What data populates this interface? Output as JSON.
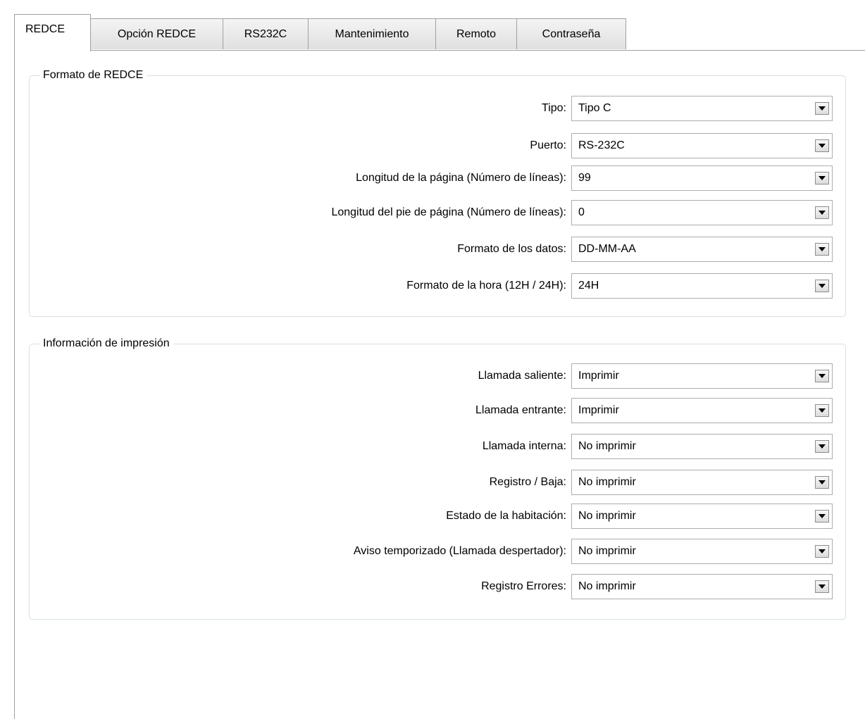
{
  "tabs": [
    {
      "label": "REDCE",
      "active": true
    },
    {
      "label": "Opción REDCE",
      "active": false
    },
    {
      "label": "RS232C",
      "active": false
    },
    {
      "label": "Mantenimiento",
      "active": false
    },
    {
      "label": "Remoto",
      "active": false
    },
    {
      "label": "Contraseña",
      "active": false
    }
  ],
  "format_group": {
    "title": "Formato de REDCE",
    "rows": [
      {
        "label": "Tipo:",
        "value": "Tipo C"
      },
      {
        "label": "Puerto:",
        "value": "RS-232C"
      },
      {
        "label": "Longitud de la página (Número de líneas):",
        "value": "99"
      },
      {
        "label": "Longitud del pie de página (Número de líneas):",
        "value": "0"
      },
      {
        "label": "Formato de los datos:",
        "value": "DD-MM-AA"
      },
      {
        "label": "Formato de la hora (12H / 24H):",
        "value": "24H"
      }
    ]
  },
  "print_group": {
    "title": "Información de impresión",
    "rows": [
      {
        "label": "Llamada saliente:",
        "value": "Imprimir"
      },
      {
        "label": "Llamada entrante:",
        "value": "Imprimir"
      },
      {
        "label": "Llamada interna:",
        "value": "No imprimir"
      },
      {
        "label": "Registro / Baja:",
        "value": "No imprimir"
      },
      {
        "label": "Estado de la habitación:",
        "value": "No imprimir"
      },
      {
        "label": "Aviso temporizado (Llamada despertador):",
        "value": "No imprimir"
      },
      {
        "label": "Registro Errores:",
        "value": "No imprimir"
      }
    ]
  },
  "icons": {
    "dropdown": "chevron-down-icon"
  }
}
